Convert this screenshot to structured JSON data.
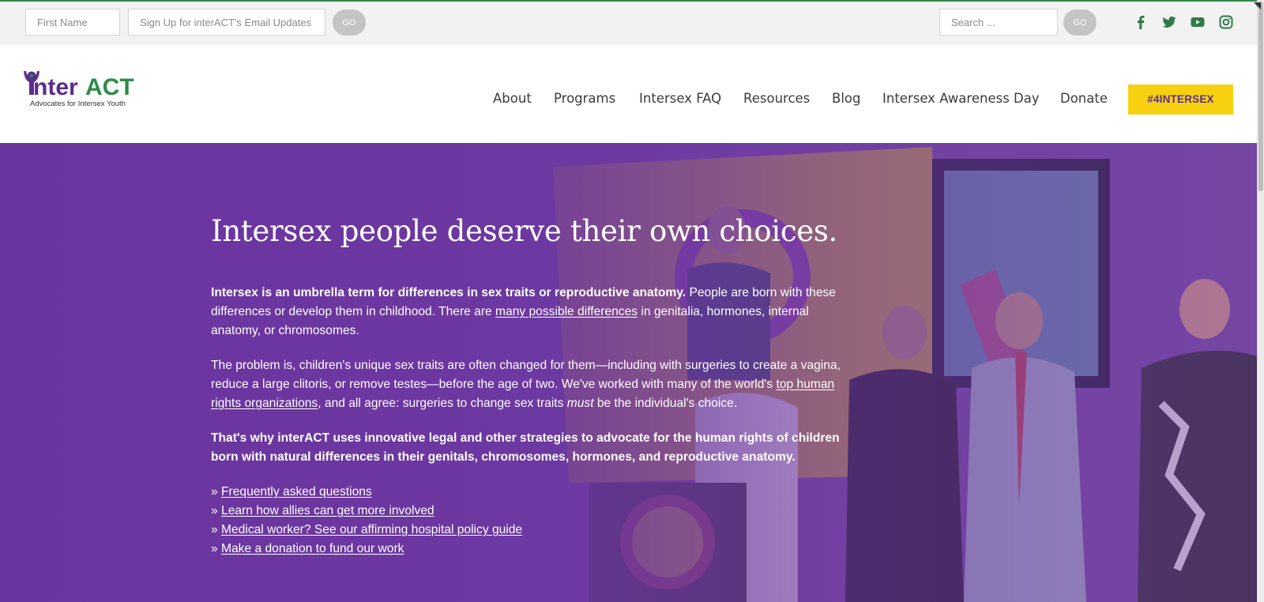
{
  "topbar": {
    "first_name_placeholder": "First Name",
    "email_placeholder": "Sign Up for interACT's Email Updates",
    "signup_go_label": "GO",
    "search_placeholder": "Search ...",
    "search_go_label": "GO",
    "social_icons": [
      "facebook-icon",
      "twitter-icon",
      "youtube-icon",
      "instagram-icon"
    ]
  },
  "logo": {
    "text": "interACT",
    "tagline": "Advocates for Intersex Youth"
  },
  "nav": {
    "items": [
      "About",
      "Programs",
      "Intersex FAQ",
      "Resources",
      "Blog",
      "Intersex Awareness Day",
      "Donate"
    ],
    "cta": "#4INTERSEX"
  },
  "hero": {
    "title": "Intersex people deserve their own choices.",
    "p1_bold": "Intersex is an umbrella term for differences in sex traits or reproductive anatomy.",
    "p1_text_a": " People are born with these differences or develop them in childhood. There are ",
    "p1_link": "many possible differences",
    "p1_text_b": " in genitalia, hormones, internal anatomy, or chromosomes.",
    "p2_text_a": "The problem is, children's unique sex traits are often changed for them—including with surgeries to create a vagina, reduce a large clitoris, or remove testes—before the age of two. We've worked with many of the world's ",
    "p2_link": "top human rights organizations",
    "p2_text_b": ", and all agree: surgeries to change sex traits ",
    "p2_em": "must",
    "p2_text_c": " be the individual's choice.",
    "p3": "That's why interACT uses innovative legal and other strategies to advocate for the human rights of children born with natural differences in their genitals, chromosomes, hormones, and reproductive anatomy.",
    "link_prefix": "» ",
    "links": [
      "Frequently asked questions",
      "Learn how allies can get more involved",
      "Medical worker? See our affirming hospital policy guide",
      "Make a donation to fund our work"
    ]
  },
  "colors": {
    "brand_purple": "#5b2c8e",
    "brand_green": "#2e8b4a",
    "cta_yellow": "#f7d10f",
    "hero_tint": "#6a34a0"
  }
}
